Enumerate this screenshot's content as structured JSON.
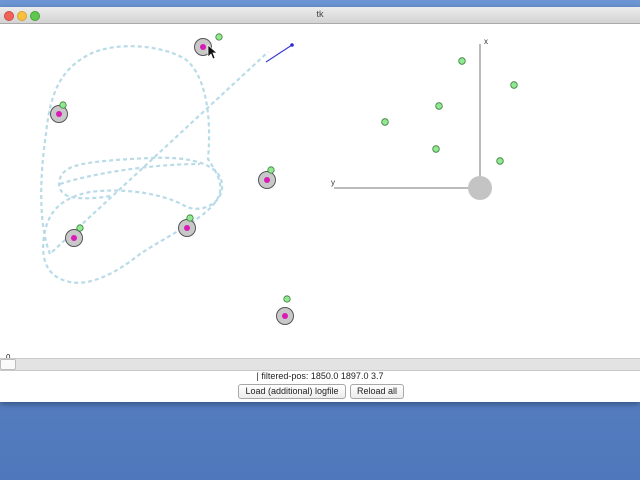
{
  "window": {
    "title": "tk"
  },
  "canvas": {
    "time_label": "0",
    "map_axis_x_label": "x",
    "map_axis_y_label": "y",
    "colors": {
      "path": "#b9dbe8",
      "robot_fill": "#c8c8c8",
      "robot_center": "#d81cb5",
      "landmark": "#90e890",
      "heading_line": "#3b3bd6",
      "axis": "#777777",
      "origin": "#c4c4c4"
    }
  },
  "status": {
    "text": "| filtered-pos: 1850.0 1897.0 3.7"
  },
  "buttons": {
    "load_label": "Load (additional) logfile",
    "reload_label": "Reload all"
  }
}
